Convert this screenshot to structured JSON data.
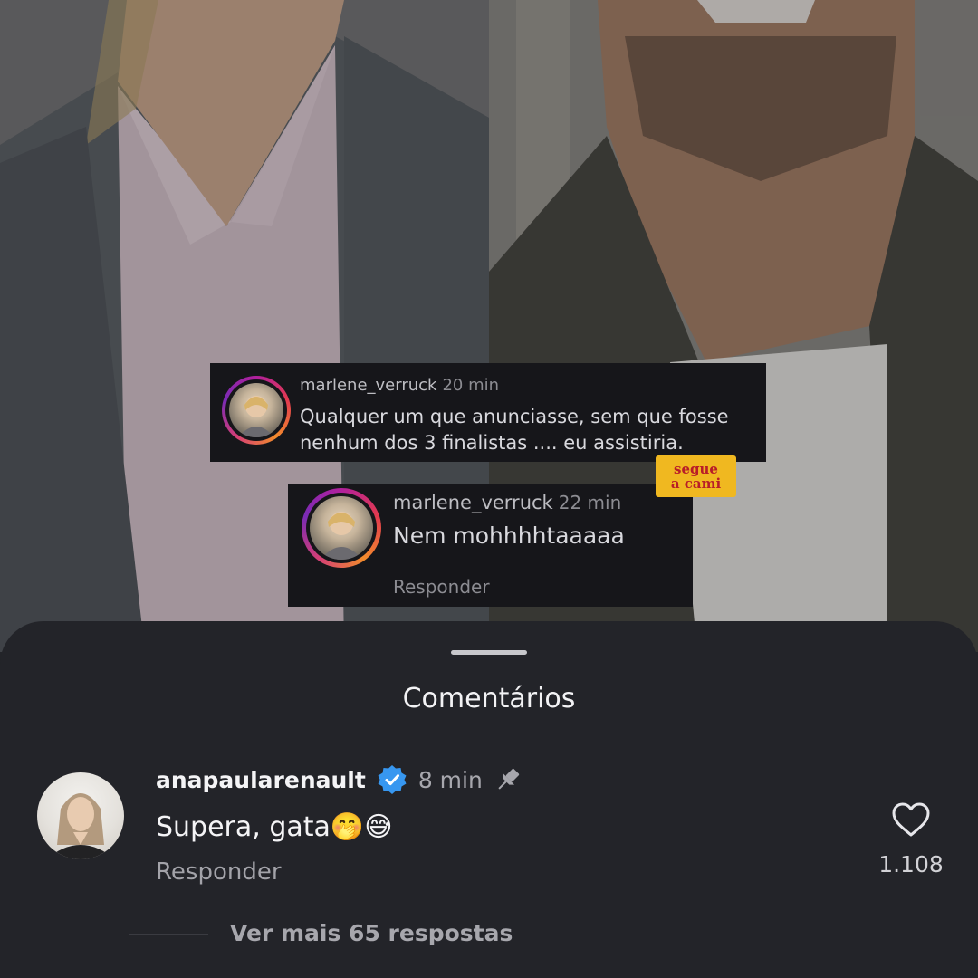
{
  "overlay_comments": [
    {
      "username": "marlene_verruck",
      "time": "20 min",
      "text_line1": "Qualquer um que anunciasse, sem que fosse",
      "text_line2": "nenhum dos 3 finalistas .... eu assistiria."
    },
    {
      "username": "marlene_verruck",
      "time": "22 min",
      "text": "Nem mohhhhtaaaaa",
      "reply_label": "Responder"
    }
  ],
  "sticker": {
    "line1": "segue",
    "line2": "a cami"
  },
  "sheet": {
    "title": "Comentários",
    "comment": {
      "username": "anapaularenault",
      "verified": true,
      "time": "8 min",
      "pinned": true,
      "text": "Supera, gata🤭😅",
      "reply_label": "Responder",
      "likes": "1.108",
      "view_more": "Ver mais 65 respostas"
    }
  },
  "icons": {
    "verified": "verified-badge-icon",
    "pin": "pin-icon",
    "like": "heart-outline-icon"
  },
  "colors": {
    "sheet_bg": "#232429",
    "verified_blue": "#3797f0",
    "sticker_bg": "#f0b820",
    "sticker_text": "#b81d28"
  }
}
